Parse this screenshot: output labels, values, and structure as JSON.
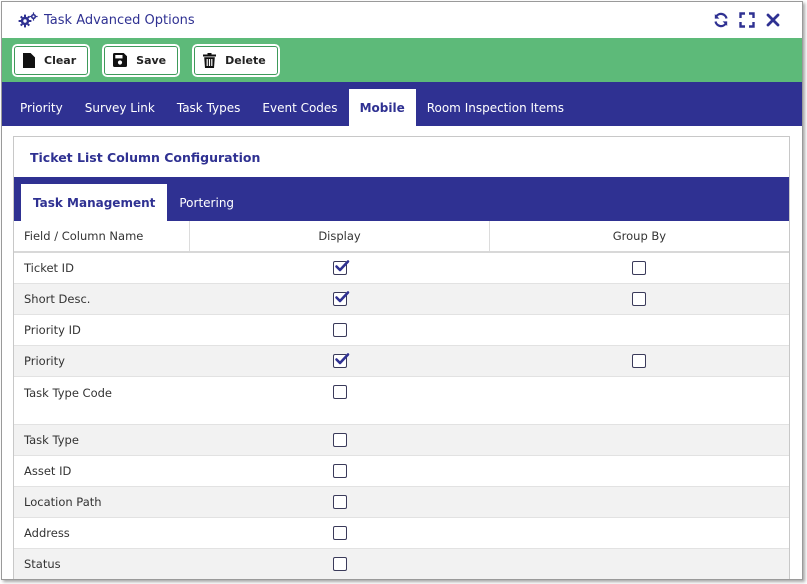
{
  "window": {
    "title": "Task Advanced Options"
  },
  "toolbar": {
    "clear_label": "Clear",
    "save_label": "Save",
    "delete_label": "Delete"
  },
  "nav_tabs": [
    {
      "label": "Priority",
      "active": false
    },
    {
      "label": "Survey Link",
      "active": false
    },
    {
      "label": "Task Types",
      "active": false
    },
    {
      "label": "Event Codes",
      "active": false
    },
    {
      "label": "Mobile",
      "active": true
    },
    {
      "label": "Room Inspection Items",
      "active": false
    }
  ],
  "panel": {
    "title": "Ticket List Column Configuration",
    "sub_tabs": [
      {
        "label": "Task Management",
        "active": true
      },
      {
        "label": "Portering",
        "active": false
      }
    ],
    "columns": {
      "field": "Field / Column Name",
      "display": "Display",
      "group_by": "Group By"
    },
    "rows": [
      {
        "field": "Ticket ID",
        "display": true,
        "group_by": false,
        "has_group_by": true
      },
      {
        "field": "Short Desc.",
        "display": true,
        "group_by": false,
        "has_group_by": true
      },
      {
        "field": "Priority ID",
        "display": false,
        "group_by": false,
        "has_group_by": false
      },
      {
        "field": "Priority",
        "display": true,
        "group_by": false,
        "has_group_by": true
      },
      {
        "field": "Task Type Code",
        "display": false,
        "group_by": false,
        "has_group_by": false
      },
      {
        "field": "Task Type",
        "display": false,
        "group_by": false,
        "has_group_by": false
      },
      {
        "field": "Asset ID",
        "display": false,
        "group_by": false,
        "has_group_by": false
      },
      {
        "field": "Location Path",
        "display": false,
        "group_by": false,
        "has_group_by": false
      },
      {
        "field": "Address",
        "display": false,
        "group_by": false,
        "has_group_by": false
      },
      {
        "field": "Status",
        "display": false,
        "group_by": false,
        "has_group_by": false
      }
    ]
  },
  "colors": {
    "brand_blue": "#2f3192",
    "toolbar_green": "#5dba79"
  },
  "icons": {
    "title": "gears-icon",
    "refresh": "refresh-icon",
    "expand": "expand-icon",
    "close": "close-icon",
    "clear": "file-icon",
    "save": "floppy-icon",
    "delete": "trash-icon"
  }
}
